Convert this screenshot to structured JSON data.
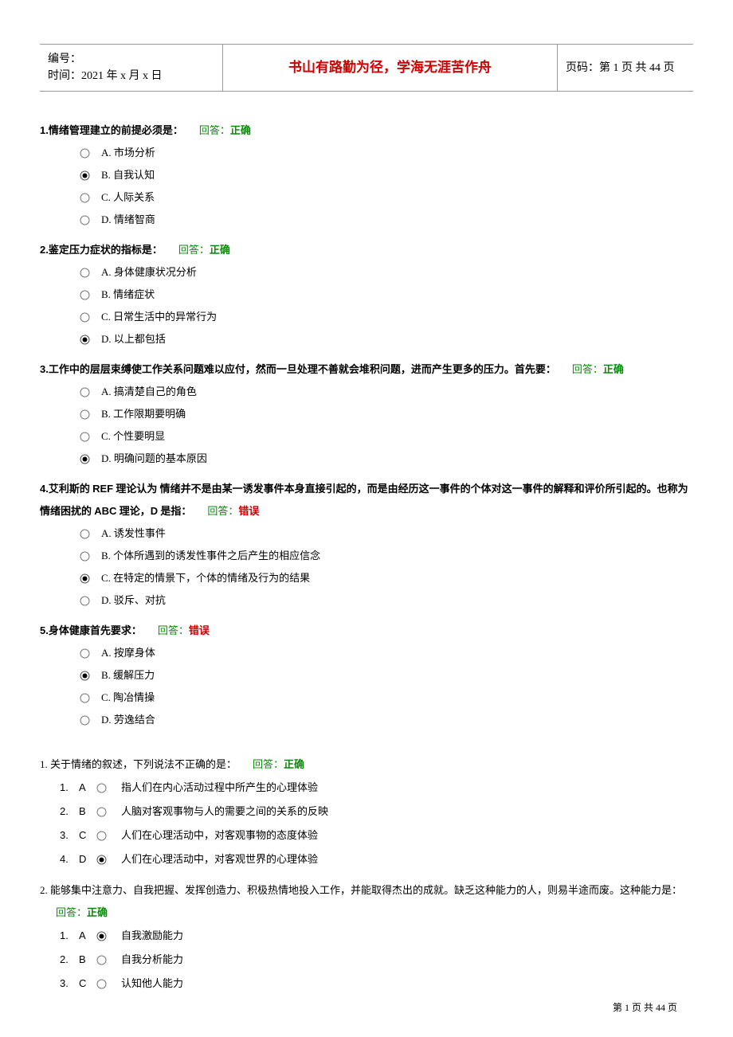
{
  "header": {
    "serial_label": "编号：",
    "time_label": "时间：2021 年 x 月 x 日",
    "motto": "书山有路勤为径，学海无涯苦作舟",
    "page_label": "页码：第 1 页  共 44 页"
  },
  "questions_a": [
    {
      "num": "1.",
      "text": "情绪管理建立的前提必须是：",
      "feedback_label": "回答：",
      "feedback_value": "正确",
      "feedback_correct": true,
      "options": [
        {
          "label": "A. 市场分析",
          "selected": false
        },
        {
          "label": "B. 自我认知",
          "selected": true
        },
        {
          "label": "C. 人际关系",
          "selected": false
        },
        {
          "label": "D. 情绪智商",
          "selected": false
        }
      ]
    },
    {
      "num": "2.",
      "text": "鉴定压力症状的指标是：",
      "feedback_label": "回答：",
      "feedback_value": "正确",
      "feedback_correct": true,
      "options": [
        {
          "label": "A. 身体健康状况分析",
          "selected": false
        },
        {
          "label": "B. 情绪症状",
          "selected": false
        },
        {
          "label": "C. 日常生活中的异常行为",
          "selected": false
        },
        {
          "label": "D. 以上都包括",
          "selected": true
        }
      ]
    },
    {
      "num": "3.",
      "text": "工作中的层层束缚使工作关系问题难以应付，然而一旦处理不善就会堆积问题，进而产生更多的压力。首先要：",
      "feedback_label": "回答：",
      "feedback_value": "正确",
      "feedback_correct": true,
      "options": [
        {
          "label": "A. 搞清楚自己的角色",
          "selected": false
        },
        {
          "label": "B. 工作限期要明确",
          "selected": false
        },
        {
          "label": "C. 个性要明显",
          "selected": false
        },
        {
          "label": "D. 明确问题的基本原因",
          "selected": true
        }
      ]
    },
    {
      "num": "4.",
      "text_pre": "艾利斯的 ",
      "text_ref": "REF",
      "text_mid": " 理论认为  情绪并不是由某一诱发事件本身直接引起的，而是由经历这一事件的个体对这一事件的解释和评价所引起的。也称为情绪困扰的 ",
      "text_abc": "ABC",
      "text_mid2": " 理论，",
      "text_d": "D",
      "text_tail": " 是指：",
      "feedback_label": "回答：",
      "feedback_value": "错误",
      "feedback_correct": false,
      "options": [
        {
          "label": "A. 诱发性事件",
          "selected": false
        },
        {
          "label": "B. 个体所遇到的诱发性事件之后产生的相应信念",
          "selected": false
        },
        {
          "label": "C. 在特定的情景下，个体的情绪及行为的结果",
          "selected": true
        },
        {
          "label": "D. 驳斥、对抗",
          "selected": false
        }
      ]
    },
    {
      "num": "5.",
      "text": "身体健康首先要求：",
      "feedback_label": "回答：",
      "feedback_value": "错误",
      "feedback_correct": false,
      "options": [
        {
          "label": "A. 按摩身体",
          "selected": false
        },
        {
          "label": "B. 缓解压力",
          "selected": true
        },
        {
          "label": "C. 陶冶情操",
          "selected": false
        },
        {
          "label": "D. 劳逸结合",
          "selected": false
        }
      ]
    }
  ],
  "questions_b": [
    {
      "num": "1. ",
      "text": "关于情绪的叙述，下列说法不正确的是：",
      "feedback_label": "回答：",
      "feedback_value": "正确",
      "feedback_correct": true,
      "options": [
        {
          "idx": "1.",
          "letter": "A",
          "label": "指人们在内心活动过程中所产生的心理体验",
          "selected": false
        },
        {
          "idx": "2.",
          "letter": "B",
          "label": "人脑对客观事物与人的需要之间的关系的反映",
          "selected": false
        },
        {
          "idx": "3.",
          "letter": "C",
          "label": "人们在心理活动中，对客观事物的态度体验",
          "selected": false
        },
        {
          "idx": "4.",
          "letter": "D",
          "label": "人们在心理活动中，对客观世界的心理体验",
          "selected": true
        }
      ]
    },
    {
      "num": "2. ",
      "text": "能够集中注意力、自我把握、发挥创造力、积极热情地投入工作，并能取得杰出的成就。缺乏这种能力的人，则易半途而废。这种能力是：",
      "feedback_label": "回答：",
      "feedback_value": "正确",
      "feedback_correct": true,
      "options": [
        {
          "idx": "1.",
          "letter": "A",
          "label": "自我激励能力",
          "selected": true
        },
        {
          "idx": "2.",
          "letter": "B",
          "label": "自我分析能力",
          "selected": false
        },
        {
          "idx": "3.",
          "letter": "C",
          "label": "认知他人能力",
          "selected": false
        }
      ]
    }
  ],
  "footer": {
    "text": "第  1  页  共  44  页"
  }
}
